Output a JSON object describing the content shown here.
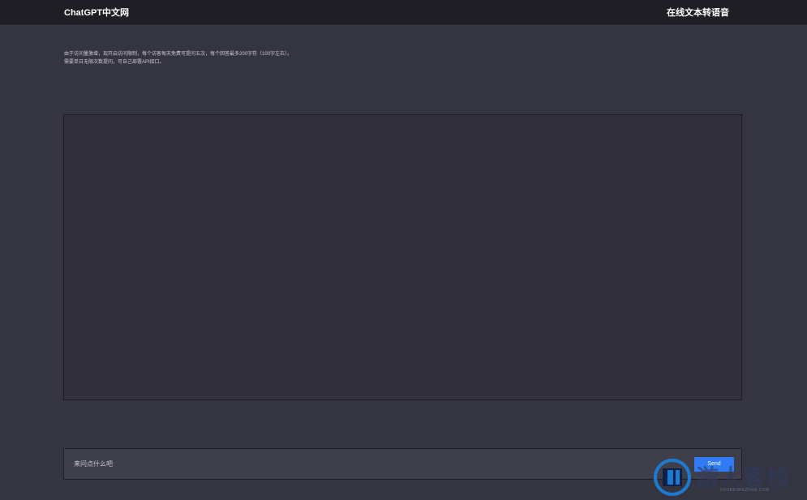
{
  "header": {
    "brand": "ChatGPT中文网",
    "title": "在线文本转语音"
  },
  "notice": {
    "lines": [
      "由于访问量激增，现开启访问限制，每个访客每天免费可提问五次，每个回答最多200字符（100字左右）。",
      "需要单日无限次数提问，可自己部署API接口。"
    ]
  },
  "chat": {
    "messages": []
  },
  "input": {
    "placeholder": "来问点什么吧",
    "value": "",
    "button_label": "Send"
  },
  "watermark": {
    "text": "游人客栈",
    "subtext": "YOURENKEZHAN.COM",
    "colors": {
      "logo_accent": "#1c7bd0",
      "logo_dark": "#0b2148"
    }
  },
  "theme": {
    "background": "#353441",
    "topbar": "#1f1e24",
    "accent": "#2f7cf6"
  }
}
